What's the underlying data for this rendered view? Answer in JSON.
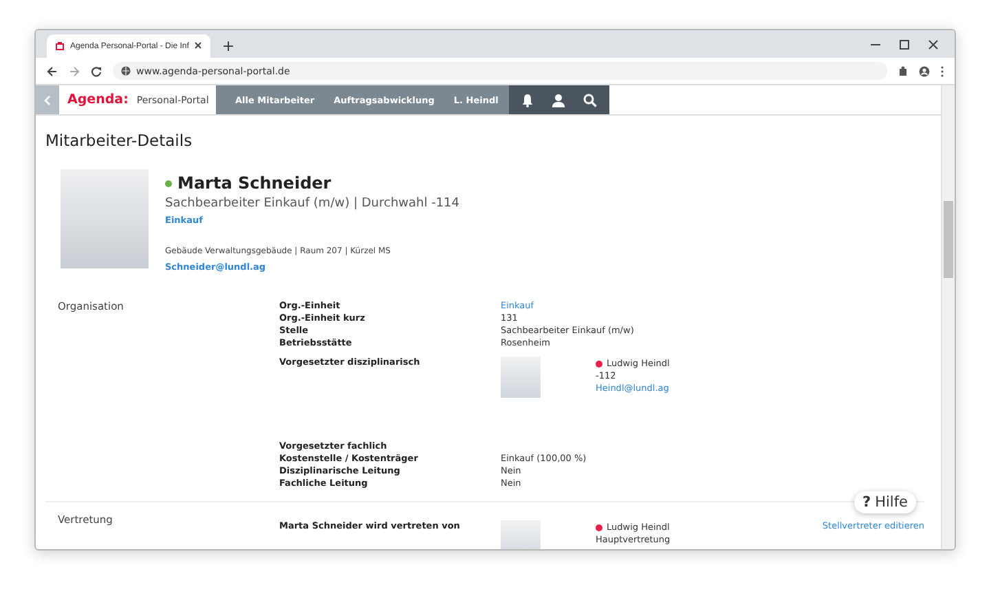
{
  "browser": {
    "tab_title": "Agenda Personal-Portal - Die Inf",
    "new_tab": "+",
    "url": "www.agenda-personal-portal.de"
  },
  "nav": {
    "logo": "Agenda:",
    "portal": "Personal-Portal",
    "links": [
      "Alle Mitarbeiter",
      "Auftragsabwicklung",
      "L. Heindl"
    ]
  },
  "page_title": "Mitarbeiter-Details",
  "employee": {
    "name": "Marta Schneider",
    "color": "#6ab04c",
    "subtitle": "Sachbearbeiter Einkauf (m/w) | Durchwahl -114",
    "department": "Einkauf",
    "location": "Gebäude Verwaltungsgebäude | Raum 207 | Kürzel MS",
    "email": "Schneider@lundl.ag"
  },
  "sections": [
    {
      "title": "Organisation",
      "rows": [
        {
          "kind": "text",
          "label": "Org.-Einheit",
          "value": "Einkauf",
          "link": true
        },
        {
          "kind": "text",
          "label": "Org.-Einheit kurz",
          "value": "131",
          "link": false
        },
        {
          "kind": "text",
          "label": "Stelle",
          "value": "Sachbearbeiter Einkauf (m/w)",
          "link": false
        },
        {
          "kind": "text",
          "label": "Betriebsstätte",
          "value": "Rosenheim",
          "link": false
        },
        {
          "kind": "person",
          "label": "Vorgesetzter disziplinarisch",
          "person": {
            "name": "Ludwig Heindl",
            "color": "#e8204a",
            "lines": [
              {
                "text": "-112",
                "link": false
              },
              {
                "text": "Heindl@lundl.ag",
                "link": true
              }
            ]
          }
        },
        {
          "kind": "text",
          "label": "Vorgesetzter fachlich"
        },
        {
          "kind": "text",
          "label": "Kostenstelle / Kostenträger",
          "value": "Einkauf (100,00 %)",
          "link": false
        },
        {
          "kind": "text",
          "label": "Disziplinarische Leitung",
          "value": "Nein",
          "link": false
        },
        {
          "kind": "text",
          "label": "Fachliche Leitung",
          "value": "Nein",
          "link": false
        }
      ]
    },
    {
      "title": "Vertretung",
      "rows": [
        {
          "kind": "person",
          "label": "Marta Schneider wird vertreten von",
          "person": {
            "name": "Ludwig Heindl",
            "color": "#e8204a",
            "lines": [
              {
                "text": "Hauptvertretung",
                "link": false
              }
            ]
          },
          "action": "Stellvertreter editieren"
        }
      ]
    }
  ],
  "help_button": {
    "mark": "?",
    "label": "Hilfe"
  }
}
